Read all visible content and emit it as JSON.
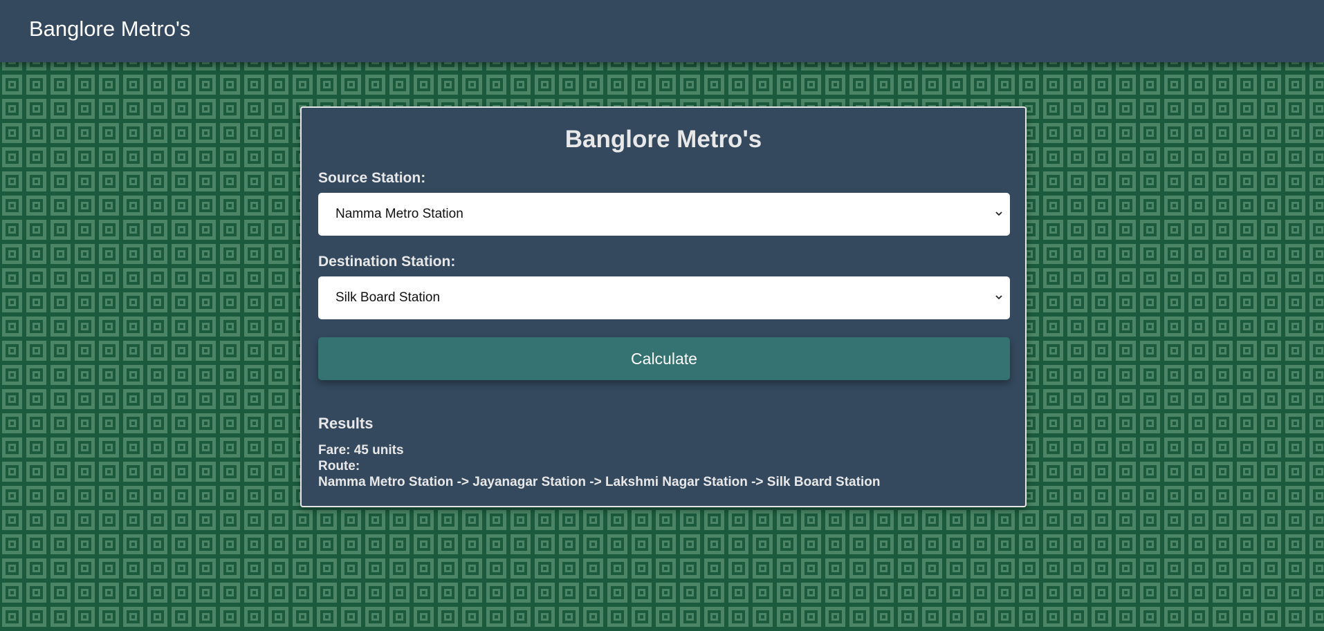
{
  "header": {
    "app_title": "Banglore Metro's"
  },
  "card": {
    "title": "Banglore Metro's",
    "source_label": "Source Station:",
    "source_value": "Namma Metro Station",
    "destination_label": "Destination Station:",
    "destination_value": "Silk Board Station",
    "calculate_label": "Calculate"
  },
  "results": {
    "title": "Results",
    "fare": "Fare: 45 units",
    "route_label": "Route:",
    "route": "Namma Metro Station -> Jayanagar Station -> Lakshmi Nagar Station -> Silk Board Station"
  },
  "icons": {
    "select_arrow": "chevron-down-icon"
  },
  "colors": {
    "header_bg": "#34495e",
    "card_bg": "#34495e",
    "button_bg": "#357272",
    "pattern_dark": "#1b5a3d",
    "pattern_light": "#4b8565"
  }
}
